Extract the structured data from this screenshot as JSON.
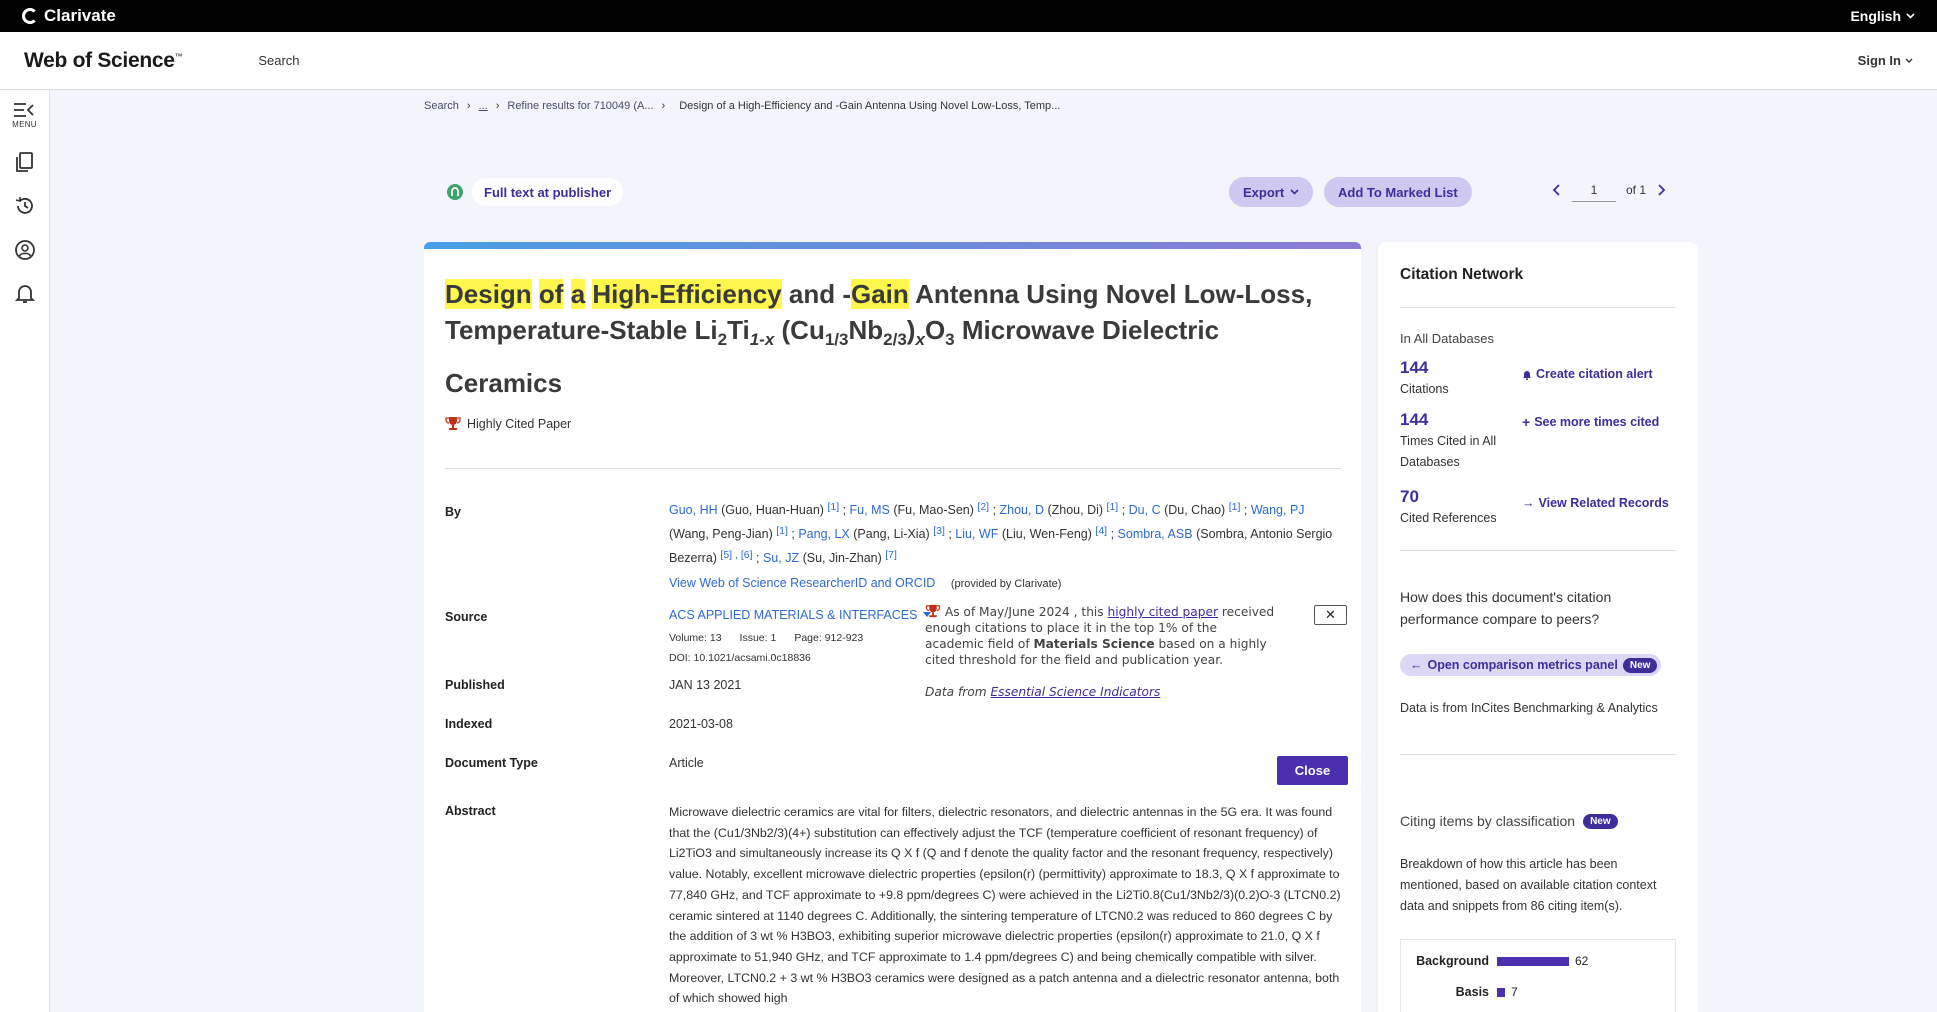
{
  "topbar": {
    "brand": "Clarivate",
    "language": "English"
  },
  "header": {
    "logo": "Web of Science",
    "logo_tm": "™",
    "search": "Search",
    "signin": "Sign In"
  },
  "sidebar": {
    "menu_label": "MENU"
  },
  "breadcrumb": {
    "search": "Search",
    "ellipsis": "...",
    "refine": "Refine results for 710049 (A...",
    "current": "Design of a High-Efficiency and -Gain Antenna Using Novel Low-Loss, Temp..."
  },
  "actions": {
    "full_text": "Full text at publisher",
    "export": "Export",
    "add_marked": "Add To Marked List",
    "page_value": "1",
    "page_of": "of 1"
  },
  "record": {
    "title": {
      "w1": "Design",
      "w2": "of",
      "w3": "a",
      "w4": "High-Efficiency",
      "w5": "and -",
      "w6": "Gain",
      "rest1": "Antenna Using Novel Low-Loss,",
      "line2_a": "Temperature-Stable Li",
      "sub1": "2",
      "line2_b": "Ti",
      "sub2": "1-x",
      "line2_c": "(Cu",
      "sub3": "1/3",
      "line2_d": "Nb",
      "sub4": "2/3",
      "line2_e": ")",
      "sub5": "x",
      "line2_f": "O",
      "sub6": "3",
      "line2_g": "Microwave Dielectric",
      "line3": "Ceramics"
    },
    "highly_cited": "Highly Cited Paper",
    "labels": {
      "by": "By",
      "source": "Source",
      "published": "Published",
      "indexed": "Indexed",
      "doctype": "Document Type",
      "abstract": "Abstract"
    },
    "authors": [
      {
        "short": "Guo, HH",
        "full": "(Guo, Huan-Huan)",
        "refs": "[1]"
      },
      {
        "short": "Fu, MS",
        "full": "(Fu, Mao-Sen)",
        "refs": "[2]"
      },
      {
        "short": "Zhou, D",
        "full": "(Zhou, Di)",
        "refs": "[1]"
      },
      {
        "short": "Du, C",
        "full": "(Du, Chao)",
        "refs": "[1]"
      },
      {
        "short": "Wang, PJ",
        "full": "(Wang, Peng-Jian)",
        "refs": "[1]"
      },
      {
        "short": "Pang, LX",
        "full": "(Pang, Li-Xia)",
        "refs": "[3]"
      },
      {
        "short": "Liu, WF",
        "full": "(Liu, Wen-Feng)",
        "refs": "[4]"
      },
      {
        "short": "Sombra, ASB",
        "full": "(Sombra, Antonio Sergio Bezerra)",
        "refs": "[5] , [6]"
      },
      {
        "short": "Su, JZ",
        "full": "(Su, Jin-Zhan)",
        "refs": "[7]"
      }
    ],
    "orcid_link": "View Web of Science ResearcherID and ORCID",
    "orcid_provided": "(provided by Clarivate)",
    "journal": "ACS APPLIED MATERIALS & INTERFACES",
    "volume": "Volume: 13",
    "issue": "Issue: 1",
    "pages": "Page: 912-923",
    "doi": "DOI: 10.1021/acsami.0c18836",
    "published": "JAN 13 2021",
    "indexed": "2021-03-08",
    "doctype": "Article",
    "abstract": "Microwave dielectric ceramics are vital for filters, dielectric resonators, and dielectric antennas in the 5G era. It was found that the (Cu1/3Nb2/3)(4+) substitution can effectively adjust the TCF (temperature coefficient of resonant frequency) of Li2TiO3 and simultaneously increase its Q X f (Q and f denote the quality factor and the resonant frequency, respectively) value. Notably, excellent microwave dielectric properties (epsilon(r) (permittivity) approximate to 18.3, Q X f approximate to 77,840 GHz, and TCF approximate to +9.8 ppm/degrees C) were achieved in the Li2Ti0.8(Cu1/3Nb2/3)(0.2)O-3 (LTCN0.2) ceramic sintered at 1140 degrees C. Additionally, the sintering temperature of LTCN0.2 was reduced to 860 degrees C by the addition of 3 wt % H3BO3, exhibiting superior microwave dielectric properties (epsilon(r) approximate to 21.0, Q X f approximate to 51,940 GHz, and TCF approximate to 1.4 ppm/degrees C) and being chemically compatible with silver. Moreover, LTCN0.2 + 3 wt % H3BO3 ceramics were designed as a patch antenna and a dielectric resonator antenna, both of which showed high"
  },
  "popup": {
    "pre": "As of May/June 2024 , this",
    "link": "highly cited paper",
    "mid": "received enough citations to place it in the top 1% of the academic field of",
    "field": "Materials Science",
    "post": "based on a highly cited threshold for the field and publication year.",
    "data_from": "Data from",
    "esi": "Essential Science Indicators",
    "close_x": "✕",
    "close": "Close"
  },
  "citation_network": {
    "title": "Citation Network",
    "in_all": "In All Databases",
    "citations": "144",
    "citations_label": "Citations",
    "times_cited": "144",
    "times_cited_label": "Times Cited in All Databases",
    "cited_refs": "70",
    "cited_refs_label": "Cited References",
    "create_alert": "Create citation alert",
    "see_more": "See more times cited",
    "view_related": "View Related Records",
    "question": "How does this document's citation performance compare to peers?",
    "open_comparison": "Open comparison metrics panel",
    "new_badge": "New",
    "data_from": "Data is from InCites Benchmarking & Analytics",
    "citing_title": "Citing items by classification",
    "citing_desc": "Breakdown of how this article has been mentioned, based on available citation context data and snippets from 86 citing item(s).",
    "classification": [
      {
        "label": "Background",
        "value": 62
      },
      {
        "label": "Basis",
        "value": 7
      }
    ]
  },
  "colors": {
    "accent": "#3d2e9c",
    "highlight": "#fff64e",
    "link": "#2d6ad4"
  }
}
